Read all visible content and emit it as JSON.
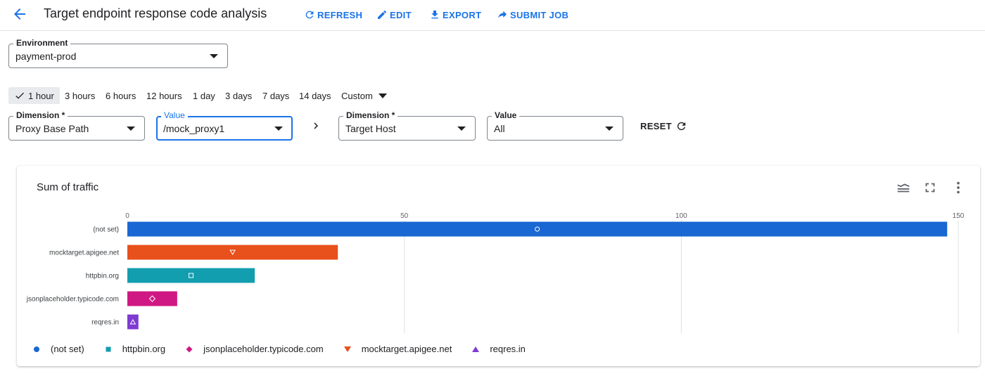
{
  "header": {
    "title": "Target endpoint response code analysis",
    "refresh_label": "REFRESH",
    "edit_label": "EDIT",
    "export_label": "EXPORT",
    "submit_label": "SUBMIT JOB"
  },
  "environment": {
    "label": "Environment",
    "value": "payment-prod"
  },
  "time_ranges": [
    "1 hour",
    "3 hours",
    "6 hours",
    "12 hours",
    "1 day",
    "3 days",
    "7 days",
    "14 days"
  ],
  "time_range_selected": "1 hour",
  "custom_label": "Custom",
  "filters": {
    "dim1": {
      "label": "Dimension *",
      "value": "Proxy Base Path"
    },
    "val1": {
      "label": "Value",
      "value": "/mock_proxy1"
    },
    "dim2": {
      "label": "Dimension *",
      "value": "Target Host"
    },
    "val2": {
      "label": "Value",
      "value": "All"
    }
  },
  "reset_label": "RESET",
  "chart_data": {
    "type": "bar",
    "orientation": "horizontal",
    "title": "Sum of traffic",
    "categories": [
      "(not set)",
      "mocktarget.apigee.net",
      "httpbin.org",
      "jsonplaceholder.typicode.com",
      "reqres.in"
    ],
    "values": [
      148,
      38,
      23,
      9,
      2
    ],
    "colors": [
      "#1967d2",
      "#e8501c",
      "#129eaf",
      "#d01884",
      "#7e3ad1"
    ],
    "markers": [
      "circle",
      "triangle-down",
      "square",
      "diamond",
      "triangle-up"
    ],
    "xlim": [
      0,
      150
    ],
    "xticks": [
      0,
      50,
      100,
      150
    ],
    "grid": true,
    "legend_position": "bottom",
    "legend": [
      {
        "name": "(not set)",
        "color": "#1967d2",
        "marker": "circle"
      },
      {
        "name": "httpbin.org",
        "color": "#129eaf",
        "marker": "square"
      },
      {
        "name": "jsonplaceholder.typicode.com",
        "color": "#d01884",
        "marker": "diamond"
      },
      {
        "name": "mocktarget.apigee.net",
        "color": "#e8501c",
        "marker": "triangle-down"
      },
      {
        "name": "reqres.in",
        "color": "#7e3ad1",
        "marker": "triangle-up"
      }
    ]
  }
}
